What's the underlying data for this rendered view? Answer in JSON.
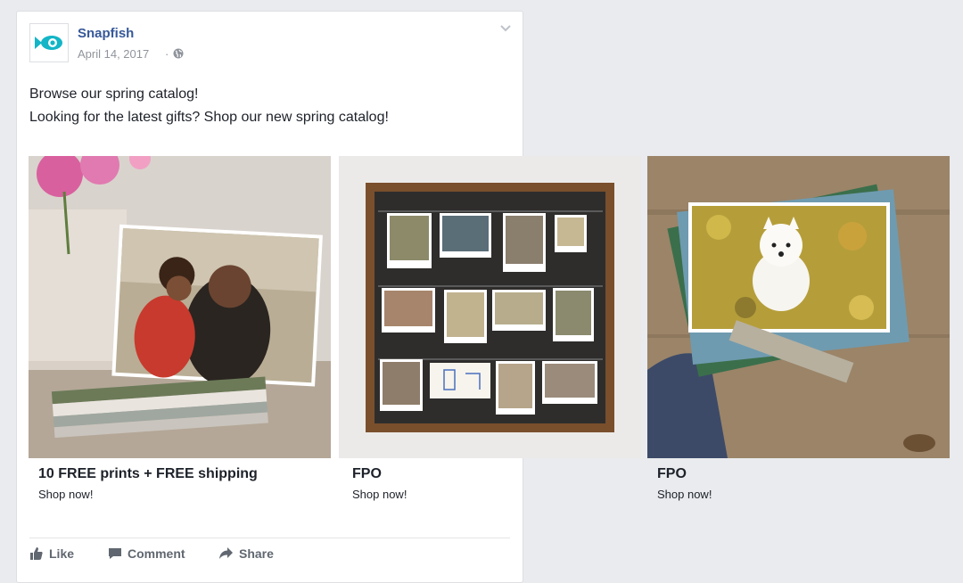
{
  "post": {
    "page_name": "Snapfish",
    "date": "April 14, 2017",
    "separator": "·",
    "line1": "Browse our spring catalog!",
    "line2": "Looking for the latest gifts? Shop our new spring catalog!"
  },
  "carousel": [
    {
      "title": "10 FREE prints + FREE shipping",
      "cta": "Shop now!"
    },
    {
      "title": "FPO",
      "cta": "Shop now!"
    },
    {
      "title": "FPO",
      "cta": "Shop now!"
    }
  ],
  "actions": {
    "like": "Like",
    "comment": "Comment",
    "share": "Share"
  },
  "colors": {
    "brand": "#365899",
    "logo": "#13b5c6",
    "meta": "#90949c",
    "action": "#606770"
  },
  "icons": [
    "snapfish-logo-icon",
    "globe-icon",
    "chevron-down-icon",
    "like-icon",
    "comment-icon",
    "share-icon"
  ]
}
